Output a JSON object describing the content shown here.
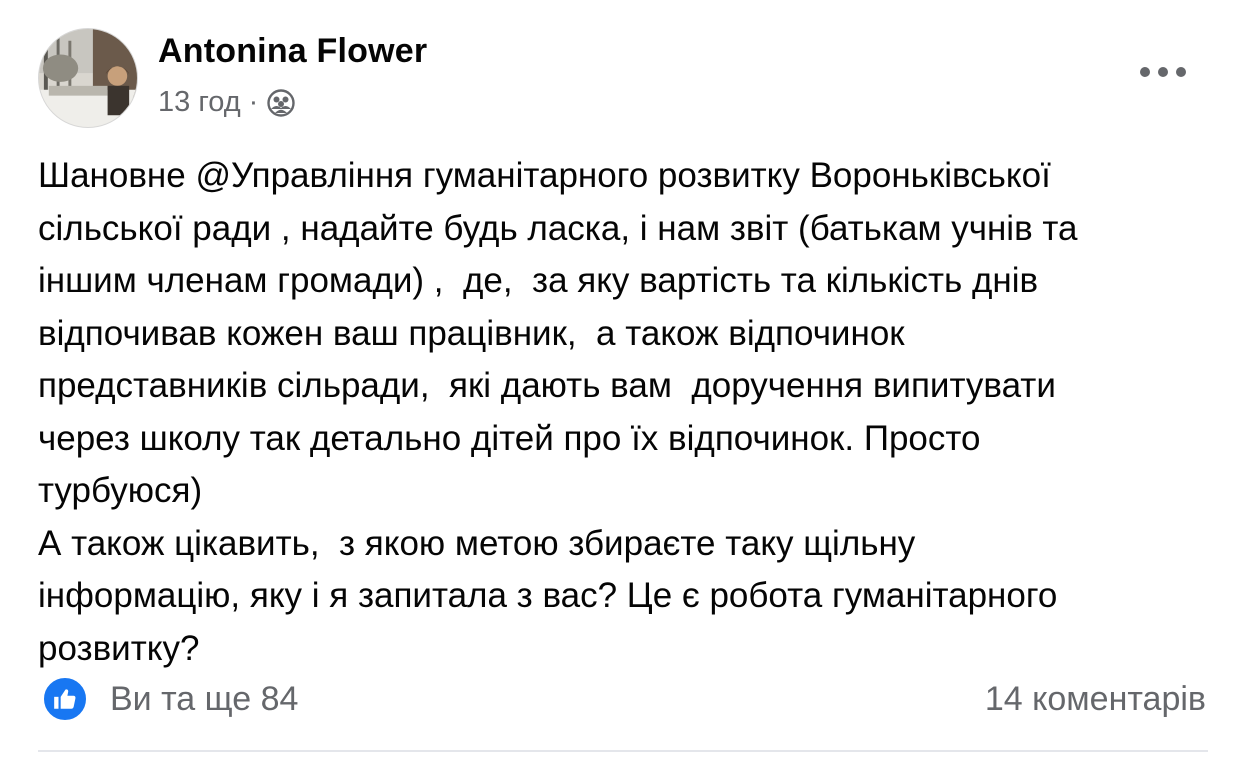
{
  "post": {
    "author": "Antonina Flower",
    "time": "13 год",
    "separator": "·",
    "audience_icon": "friends-icon",
    "more_icon": "more-options-icon",
    "text_lines": [
      "Шановне @Управління гуманітарного розвитку Вороньківської",
      "сільської ради , надайте будь ласка, і нам звіт (батькам учнів та",
      "іншим членам громади) ,  де,  за яку вартість та кількість днів",
      "відпочивав кожен ваш працівник,  а також відпочинок",
      "представників сільради,  які дають вам  доручення випитувати",
      "через школу так детально дітей про їх відпочинок. Просто",
      "турбуюся)",
      "А також цікавить,  з якою метою збираєте таку щільну",
      "інформацію, яку і я запитала з вас? Це є робота гуманітарного",
      "розвитку?"
    ],
    "reactions": {
      "icon": "like-icon",
      "text": "Ви та ще 84"
    },
    "comments_text": "14 коментарів"
  },
  "colors": {
    "text_primary": "#050505",
    "text_secondary": "#65676b",
    "like_blue": "#1877f2",
    "divider": "#e4e6eb"
  }
}
